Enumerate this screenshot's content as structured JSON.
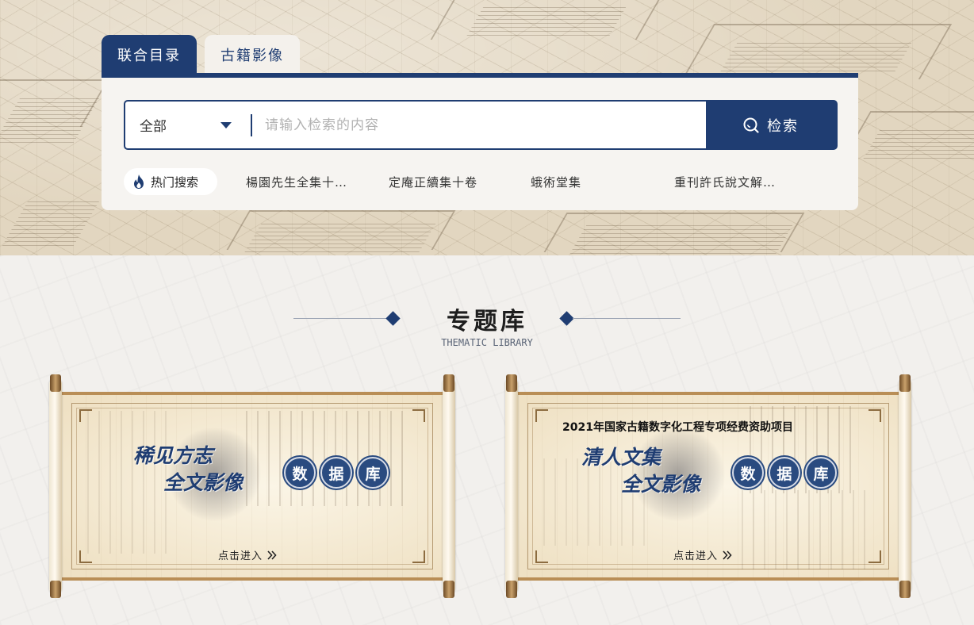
{
  "search": {
    "tabs": [
      {
        "label": "联合目录",
        "active": true
      },
      {
        "label": "古籍影像",
        "active": false
      }
    ],
    "scope_value": "全部",
    "placeholder": "请输入检索的内容",
    "button_label": "检索",
    "hot_label": "热门搜索",
    "hot_items": [
      "楊園先生全集十…",
      "定庵正續集十卷",
      "蛾術堂集",
      "重刊許氏說文解…"
    ]
  },
  "section": {
    "title": "专题库",
    "subtitle": "THEMATIC LIBRARY"
  },
  "databases": [
    {
      "project": "",
      "title_line1": "稀见方志",
      "title_line2": "全文影像",
      "badges": [
        "数",
        "据",
        "库"
      ],
      "enter_label": "点击进入"
    },
    {
      "project": "2021年国家古籍数字化工程专项经费资助项目",
      "title_line1": "清人文集",
      "title_line2": "全文影像",
      "badges": [
        "数",
        "据",
        "库"
      ],
      "enter_label": "点击进入"
    }
  ],
  "colors": {
    "brand_navy": "#1f3d72",
    "paper": "#f5ebd6",
    "scroll_wood": "#b98e56"
  },
  "icons": {
    "caret": "chevron-down-icon",
    "search": "search-icon",
    "hot": "flame-icon",
    "enter": "double-chevron-right-icon"
  }
}
